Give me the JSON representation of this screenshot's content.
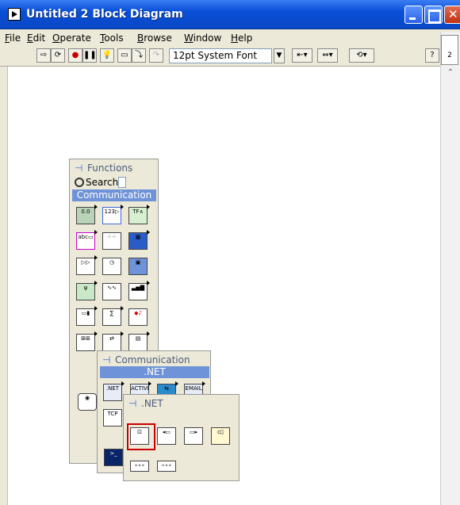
{
  "window": {
    "title": "Untitled 2 Block Diagram"
  },
  "menu": [
    "File",
    "Edit",
    "Operate",
    "Tools",
    "Browse",
    "Window",
    "Help"
  ],
  "menu_underline": [
    "F",
    "E",
    "O",
    "T",
    "B",
    "W",
    "H"
  ],
  "toolbar": {
    "font": "12pt System Font",
    "help": "?"
  },
  "functions_palette": {
    "title": "Functions",
    "search": "Search",
    "category": "Communication",
    "icons": [
      "numeric",
      "boolean",
      "string",
      "array",
      "cluster",
      "comparison",
      "timing",
      "dialog",
      "file-io",
      "waveform",
      "analyze",
      "instrument-io",
      "motion",
      "mathematics",
      "signal",
      "graphics-sound",
      "application-control",
      "communication",
      "report",
      "select-vi",
      "extra"
    ]
  },
  "communication_palette": {
    "title": "Communication",
    "category": ".NET",
    "icons": [
      ".NET",
      "ACTIVEX",
      "DataSocket",
      "EMAIL",
      "TCP",
      "UDP",
      "IrDA",
      "Bluetooth"
    ]
  },
  "net_palette": {
    "title": ".NET",
    "icons": [
      "constructor-node",
      "property-node",
      "invoke-node",
      "to-dotnet-object",
      "dotnet-reference",
      "register-event",
      "unregister-event"
    ],
    "icon_captions": [
      ".NET",
      "ACTIVEX",
      "EMAIL",
      "TCP"
    ]
  },
  "colors": {
    "titlebar": "#0a4fd6",
    "menubar": "#ece9d8",
    "category_header": "#6f93d8",
    "selection": "#cc0000"
  }
}
